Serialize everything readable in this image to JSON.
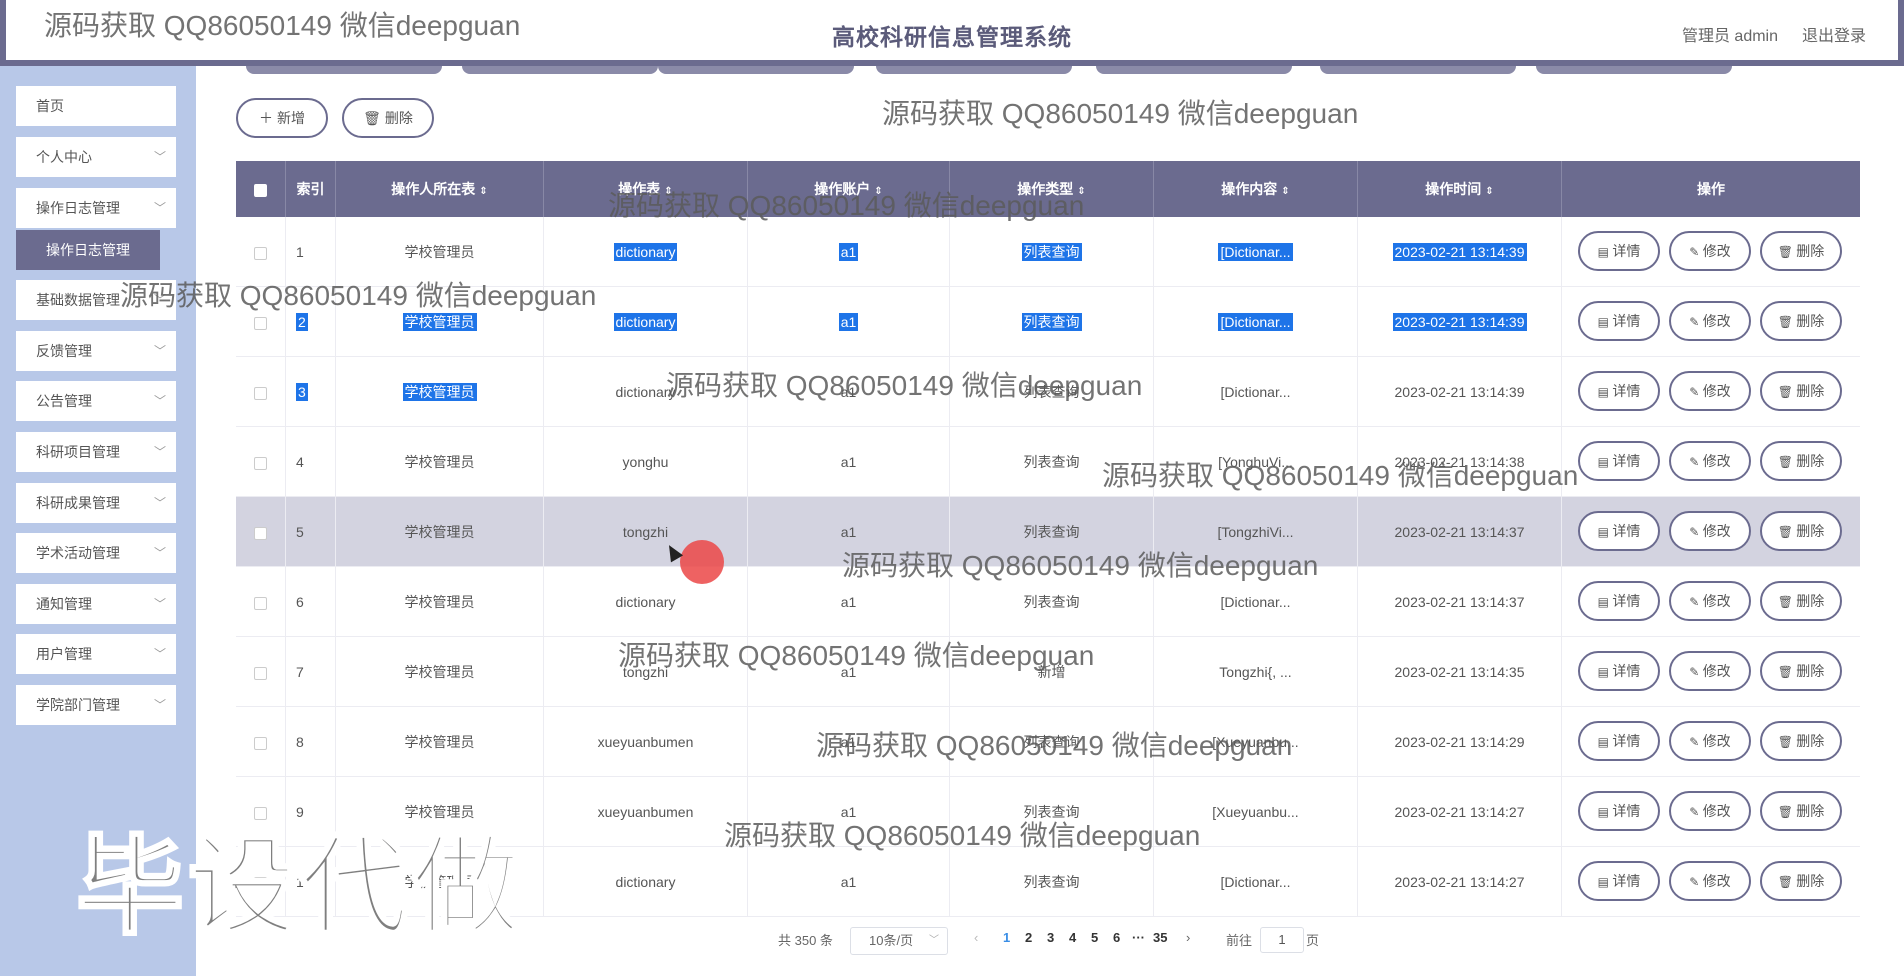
{
  "header": {
    "app_title": "高校科研信息管理系统",
    "user_label": "管理员 admin",
    "logout_label": "退出登录"
  },
  "sidebar": {
    "items": [
      {
        "label": "首页",
        "has_chevron": false
      },
      {
        "label": "个人中心",
        "has_chevron": true
      },
      {
        "label": "操作日志管理",
        "has_chevron": true
      },
      {
        "label": "基础数据管理",
        "has_chevron": true
      },
      {
        "label": "反馈管理",
        "has_chevron": true
      },
      {
        "label": "公告管理",
        "has_chevron": true
      },
      {
        "label": "科研项目管理",
        "has_chevron": true
      },
      {
        "label": "科研成果管理",
        "has_chevron": true
      },
      {
        "label": "学术活动管理",
        "has_chevron": true
      },
      {
        "label": "通知管理",
        "has_chevron": true
      },
      {
        "label": "用户管理",
        "has_chevron": true
      },
      {
        "label": "学院部门管理",
        "has_chevron": true
      }
    ],
    "active_sub": "操作日志管理"
  },
  "toolbar": {
    "add_label": "新增",
    "delete_label": "删除"
  },
  "table": {
    "headers": [
      "索引",
      "操作人所在表",
      "操作表",
      "操作账户",
      "操作类型",
      "操作内容",
      "操作时间",
      "操作"
    ],
    "rows": [
      [
        "1",
        "学校管理员",
        "dictionary",
        "a1",
        "列表查询",
        "[Dictionar...",
        "2023-02-21 13:14:39"
      ],
      [
        "2",
        "学校管理员",
        "dictionary",
        "a1",
        "列表查询",
        "[Dictionar...",
        "2023-02-21 13:14:39"
      ],
      [
        "3",
        "学校管理员",
        "dictionary",
        "a1",
        "列表查询",
        "[Dictionar...",
        "2023-02-21 13:14:39"
      ],
      [
        "4",
        "学校管理员",
        "yonghu",
        "a1",
        "列表查询",
        "[YonghuVi...",
        "2023-02-21 13:14:38"
      ],
      [
        "5",
        "学校管理员",
        "tongzhi",
        "a1",
        "列表查询",
        "[TongzhiVi...",
        "2023-02-21 13:14:37"
      ],
      [
        "6",
        "学校管理员",
        "dictionary",
        "a1",
        "列表查询",
        "[Dictionar...",
        "2023-02-21 13:14:37"
      ],
      [
        "7",
        "学校管理员",
        "tongzhi",
        "a1",
        "新增",
        "Tongzhi{, ...",
        "2023-02-21 13:14:35"
      ],
      [
        "8",
        "学校管理员",
        "xueyuanbumen",
        "a1",
        "列表查询",
        "[Xueyuanbu...",
        "2023-02-21 13:14:29"
      ],
      [
        "9",
        "学校管理员",
        "xueyuanbumen",
        "a1",
        "列表查询",
        "[Xueyuanbu...",
        "2023-02-21 13:14:27"
      ],
      [
        "10",
        "学校管理员",
        "dictionary",
        "a1",
        "列表查询",
        "[Dictionar...",
        "2023-02-21 13:14:27"
      ]
    ],
    "row_actions": [
      "详情",
      "修改",
      "删除"
    ]
  },
  "pagination": {
    "total": "共 350 条",
    "page_size": "10条/页",
    "pages": [
      "1",
      "2",
      "3",
      "4",
      "5",
      "6",
      "35"
    ],
    "ellipsis": "···",
    "current": "1",
    "goto_label": "前往",
    "goto_value": "1",
    "page_unit": "页"
  },
  "watermarks": {
    "text": "源码获取 QQ86050149 微信deepguan",
    "big_text": "毕设代做"
  },
  "colors": {
    "primary": "#6b6b8f",
    "sidebar_bg": "#b8c8e8",
    "selection": "#1e74e8",
    "highlight_row": "#d3d3e0"
  }
}
